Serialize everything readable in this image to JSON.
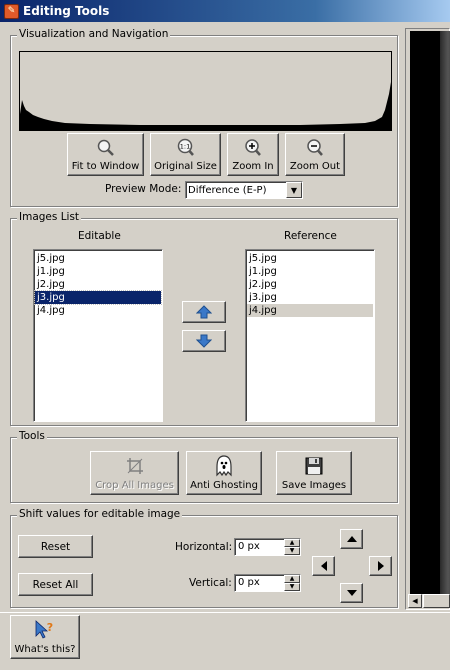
{
  "window": {
    "title": "Editing Tools"
  },
  "visualization": {
    "legend": "Visualization and Navigation",
    "buttons": [
      {
        "label": "Fit to Window",
        "icon": "magnifier-icon"
      },
      {
        "label": "Original Size",
        "icon": "zoom-1to1-icon"
      },
      {
        "label": "Zoom In",
        "icon": "zoom-in-icon"
      },
      {
        "label": "Zoom Out",
        "icon": "zoom-out-icon"
      }
    ],
    "preview_mode_label": "Preview Mode:",
    "preview_mode_value": "Difference (E-P)"
  },
  "images_list": {
    "legend": "Images List",
    "editable_header": "Editable",
    "reference_header": "Reference",
    "editable_items": [
      "j5.jpg",
      "j1.jpg",
      "j2.jpg",
      "j3.jpg",
      "j4.jpg"
    ],
    "editable_selected_index": 3,
    "reference_items": [
      "j5.jpg",
      "j1.jpg",
      "j2.jpg",
      "j3.jpg",
      "j4.jpg"
    ],
    "reference_selected_index": 4
  },
  "tools": {
    "legend": "Tools",
    "buttons": [
      {
        "label": "Crop All Images",
        "icon": "crop-icon",
        "enabled": false
      },
      {
        "label": "Anti Ghosting",
        "icon": "ghost-icon",
        "enabled": true
      },
      {
        "label": "Save Images",
        "icon": "floppy-disk-icon",
        "enabled": true
      }
    ]
  },
  "shift": {
    "legend": "Shift values for editable image",
    "reset_label": "Reset",
    "reset_all_label": "Reset All",
    "horizontal_label": "Horizontal:",
    "horizontal_value": "0 px",
    "vertical_label": "Vertical:",
    "vertical_value": "0 px"
  },
  "help": {
    "label": "What's this?",
    "icon": "whats-this-icon"
  },
  "colors": {
    "face": "#d4d0c8",
    "selection": "#0a246a",
    "arrow_blue": "#3a78c8",
    "titlebar_start": "#0a246a"
  }
}
